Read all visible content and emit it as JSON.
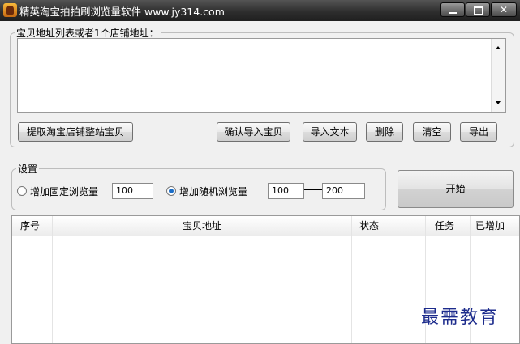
{
  "window": {
    "title": "精英淘宝拍拍刷浏览量软件 www.jy314.com",
    "icons": [
      "app-icon",
      "minimize-icon",
      "maximize-icon",
      "close-icon"
    ]
  },
  "address_group": {
    "legend": "宝贝地址列表或者1个店铺地址：",
    "textarea_value": ""
  },
  "actions": {
    "extract": "提取淘宝店铺整站宝贝",
    "confirm_import": "确认导入宝贝",
    "import_text": "导入文本",
    "delete": "删除",
    "clear": "清空",
    "export": "导出"
  },
  "settings": {
    "legend": "设置",
    "fixed_label": "增加固定浏览量",
    "fixed_value": "100",
    "fixed_selected": false,
    "random_label": "增加随机浏览量",
    "random_selected": true,
    "random_min": "100",
    "random_max": "200"
  },
  "start_button": "开始",
  "table": {
    "columns": [
      "序号",
      "宝贝地址",
      "状态",
      "任务",
      "已增加"
    ],
    "rows": []
  },
  "watermark": "最需教育"
}
